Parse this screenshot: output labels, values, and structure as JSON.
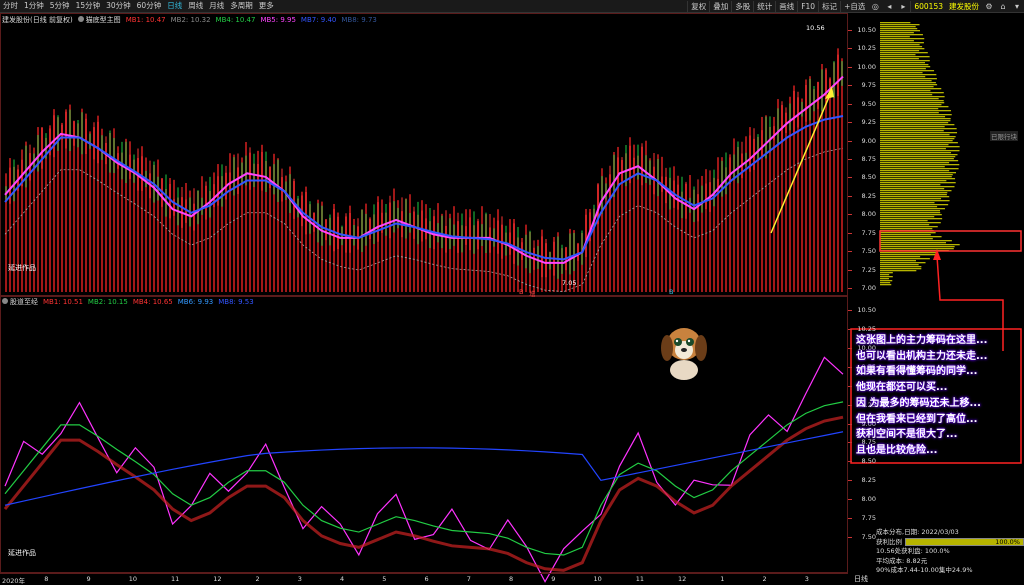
{
  "toolbar": {
    "periods": [
      "分时",
      "1分钟",
      "5分钟",
      "15分钟",
      "30分钟",
      "60分钟",
      "日线",
      "周线",
      "月线",
      "多周期",
      "更多"
    ],
    "active_period": "日线",
    "right_buttons": [
      "复权",
      "叠加",
      "多股",
      "统计",
      "画线",
      "F10",
      "标记",
      "+自选"
    ],
    "stock_code": "600153",
    "stock_name": "建发股份"
  },
  "main_chart": {
    "title": "建发股份(日线 前复权)",
    "indicator": "猫底型主图",
    "ma": [
      {
        "label": "MB1: 10.47",
        "color": "#ff3333"
      },
      {
        "label": "MB2: 10.32",
        "color": "#888888"
      },
      {
        "label": "MB4: 10.47",
        "color": "#22cc44"
      },
      {
        "label": "MB5: 9.95",
        "color": "#ff44ff"
      },
      {
        "label": "MB7: 9.40",
        "color": "#3355ff"
      },
      {
        "label": "MB8: 9.73",
        "color": "#335599"
      }
    ],
    "price_labels": [
      "10.50",
      "10.25",
      "10.00",
      "9.75",
      "9.50",
      "9.25",
      "9.00",
      "8.75",
      "8.50",
      "8.25",
      "8.00",
      "7.75",
      "7.50",
      "7.25",
      "7.00"
    ],
    "high_label": "10.56",
    "low_label": "7.05",
    "author": "延进作品",
    "markers": [
      "B",
      "增",
      "B"
    ]
  },
  "sub_chart": {
    "title": "股道至经",
    "ma": [
      {
        "label": "MB1: 10.51",
        "color": "#ff3333"
      },
      {
        "label": "MB2: 10.15",
        "color": "#22cc44"
      },
      {
        "label": "MB4: 10.65",
        "color": "#ff3333"
      },
      {
        "label": "MB6: 9.93",
        "color": "#3399ff"
      },
      {
        "label": "MB8: 9.53",
        "color": "#3355ff"
      }
    ],
    "price_labels": [
      "10.50",
      "10.25",
      "10.00",
      "9.75",
      "9.50",
      "9.25",
      "9.00",
      "8.75",
      "8.50",
      "8.25",
      "8.00",
      "7.75",
      "7.50"
    ],
    "author": "延进作品"
  },
  "x_axis": {
    "labels": [
      "2020年",
      "8",
      "9",
      "10",
      "11",
      "12",
      "2",
      "3",
      "4",
      "5",
      "6",
      "7",
      "8",
      "9",
      "10",
      "11",
      "12",
      "1",
      "2",
      "3"
    ],
    "period": "日线"
  },
  "side_label": "已限行块",
  "annotation": [
    "这张图上的主力筹码在这里...",
    "也可以看出机构主力还未走...",
    "如果有看得懂筹码的同学...",
    "他现在都还可以买...",
    "因 为最多的筹码还未上移...",
    "但在我看来已经到了高位...",
    "获利空间不是很大了...",
    "且也是比较危险..."
  ],
  "chip_panel": {
    "title": "成本分布,日期: 2022/03/03",
    "profit_label": "获利比例",
    "profit_value": "100.0%",
    "profit_line": "10.56处获利盘: 100.0%",
    "avg_cost": "平均成本: 8.82元",
    "range": "90%成本7.44-10.00集中24.9%"
  },
  "colors": {
    "up": "#ff3333",
    "down": "#22cc44",
    "ma_pink": "#ff44ff",
    "ma_blue": "#3355ff",
    "volume_bar": "#c81e1e",
    "chip": "#b6b400"
  },
  "chart_data": {
    "type": "line",
    "series": [
      {
        "name": "MB5",
        "values": [
          8.3,
          8.6,
          8.9,
          9.15,
          9.1,
          8.95,
          8.75,
          8.6,
          8.4,
          8.1,
          8.0,
          8.2,
          8.45,
          8.6,
          8.55,
          8.35,
          8.0,
          7.8,
          7.7,
          7.7,
          7.85,
          7.95,
          7.85,
          7.75,
          7.7,
          7.7,
          7.7,
          7.6,
          7.45,
          7.35,
          7.35,
          7.5,
          8.2,
          8.6,
          8.7,
          8.5,
          8.25,
          8.1,
          8.3,
          8.6,
          8.8,
          9.05,
          9.3,
          9.5,
          9.7,
          9.95
        ]
      },
      {
        "name": "MB7",
        "values": [
          8.2,
          8.5,
          8.8,
          9.1,
          9.1,
          8.95,
          8.78,
          8.62,
          8.45,
          8.2,
          8.05,
          8.15,
          8.35,
          8.5,
          8.5,
          8.35,
          8.05,
          7.85,
          7.75,
          7.7,
          7.8,
          7.9,
          7.85,
          7.78,
          7.72,
          7.7,
          7.68,
          7.62,
          7.5,
          7.42,
          7.4,
          7.5,
          8.05,
          8.45,
          8.6,
          8.5,
          8.3,
          8.15,
          8.25,
          8.5,
          8.7,
          8.9,
          9.1,
          9.25,
          9.35,
          9.4
        ]
      }
    ],
    "ylim": [
      7.0,
      10.6
    ]
  }
}
